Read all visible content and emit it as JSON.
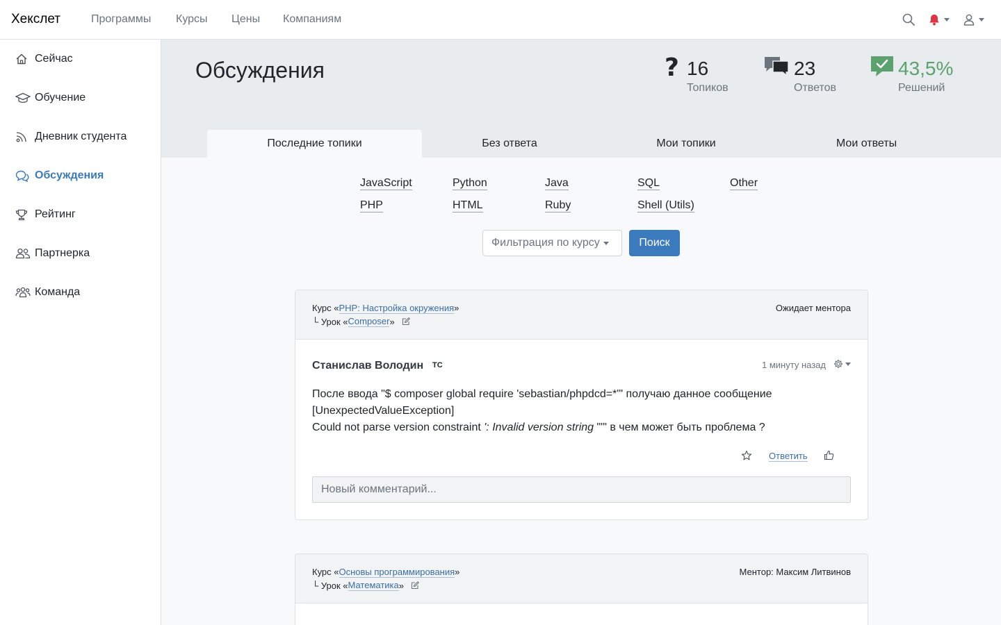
{
  "navbar": {
    "brand": "Хекслет",
    "links": [
      "Программы",
      "Курсы",
      "Цены",
      "Компаниям"
    ]
  },
  "sidebar": {
    "items": [
      {
        "label": "Сейчас",
        "icon": "home-icon"
      },
      {
        "label": "Обучение",
        "icon": "graduation-cap-icon"
      },
      {
        "label": "Дневник студента",
        "icon": "broadcast-icon"
      },
      {
        "label": "Обсуждения",
        "icon": "chat-bubbles-icon",
        "active": true
      },
      {
        "label": "Рейтинг",
        "icon": "trophy-icon"
      },
      {
        "label": "Партнерка",
        "icon": "users-icon"
      },
      {
        "label": "Команда",
        "icon": "team-icon"
      }
    ]
  },
  "header": {
    "title": "Обсуждения",
    "stats": [
      {
        "value": "16",
        "label": "Топиков",
        "icon": "question-icon"
      },
      {
        "value": "23",
        "label": "Ответов",
        "icon": "comments-icon"
      },
      {
        "value": "43,5%",
        "label": "Решений",
        "icon": "check-comment-icon"
      }
    ],
    "tabs": [
      "Последние топики",
      "Без ответа",
      "Мои топики",
      "Мои ответы"
    ]
  },
  "languages": [
    "JavaScript",
    "Python",
    "Java",
    "SQL",
    "Other",
    "PHP",
    "HTML",
    "Ruby",
    "Shell (Utils)"
  ],
  "filter": {
    "select_label": "Фильтрация по курсу",
    "search_label": "Поиск"
  },
  "topics": [
    {
      "course_prefix": "Курс «",
      "course": "PHP: Настройка окружения",
      "course_suffix": "»",
      "lesson_prefix": "└ Урок «",
      "lesson": "Composer",
      "lesson_suffix": "»",
      "status": "Ожидает ментора",
      "author": "Станислав Володин",
      "author_badge": "ТС",
      "time": "1 минуту назад",
      "body_line1": "После ввода \"$ composer global require 'sebastian/phpdcd=*'\" получаю данное сообщение",
      "body_line2": "[UnexpectedValueException]",
      "body_line3_a": "Could not parse version constraint ",
      "body_line3_italic": "': Invalid version string",
      "body_line3_b": " \"'\" в чем может быть проблема ?",
      "reply_label": "Ответить",
      "comment_placeholder": "Новый комментарий..."
    },
    {
      "course_prefix": "Курс «",
      "course": "Основы программирования",
      "course_suffix": "»",
      "lesson_prefix": "└ Урок «",
      "lesson": "Математика",
      "lesson_suffix": "»",
      "status": "Ментор: Максим Литвинов"
    }
  ]
}
